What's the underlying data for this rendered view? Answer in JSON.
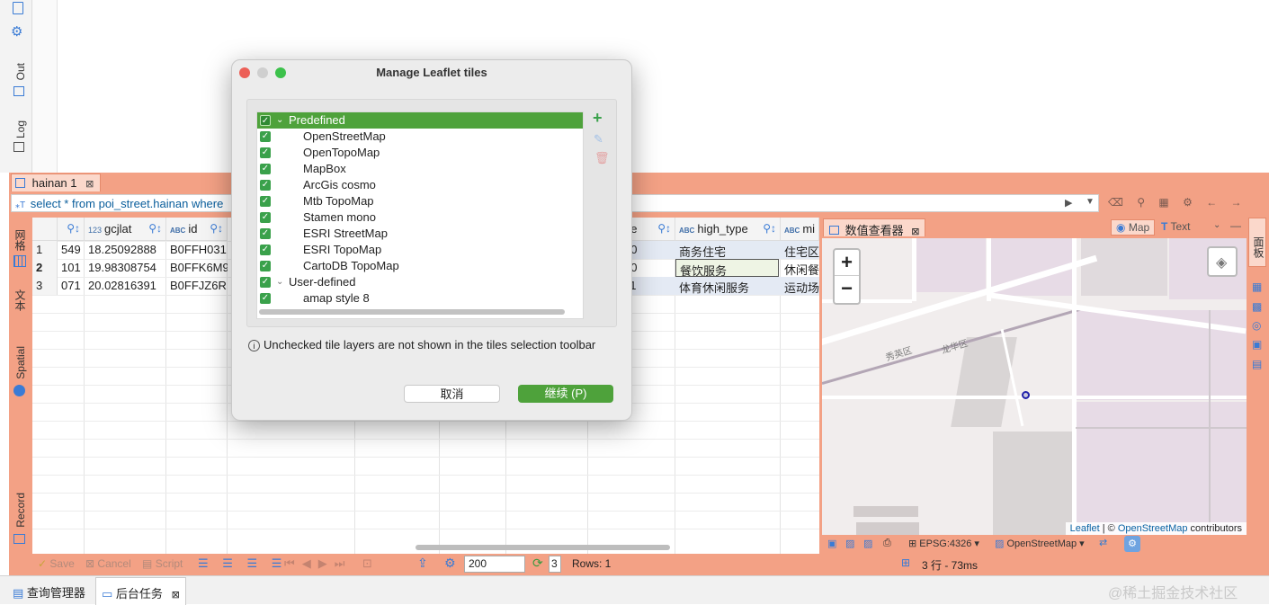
{
  "left_labels": {
    "out": "Out",
    "log": "Log",
    "grid": "网格",
    "text": "文本",
    "spatial": "Spatial",
    "record": "Record"
  },
  "editor_tab": {
    "label": "hainan 1"
  },
  "query": {
    "text": "select * from poi_street.hainan where"
  },
  "grid": {
    "columns": [
      {
        "type_badge": "",
        "label": ""
      },
      {
        "type_badge": "123",
        "label": "gcjlat"
      },
      {
        "type_badge": "ABC",
        "label": "id"
      },
      {
        "type_badge": "",
        "label": "de"
      },
      {
        "type_badge": "ABC",
        "label": "high_type"
      },
      {
        "type_badge": "ABC",
        "label": "mi"
      }
    ],
    "rows": [
      {
        "num": "1",
        "c0": "549",
        "gcjlat": "18.25092888",
        "id": "B0FFH031",
        "de": "00",
        "high_type": "商务住宅",
        "mi": "住宅区"
      },
      {
        "num": "2",
        "c0": "101",
        "gcjlat": "19.98308754",
        "id": "B0FFK6M9",
        "de": "00",
        "high_type": "餐饮服务",
        "mi": "休闲餐"
      },
      {
        "num": "3",
        "c0": "071",
        "gcjlat": "20.02816391",
        "id": "B0FFJZ6R",
        "de": "11",
        "high_type": "体育休闲服务",
        "mi": "运动场"
      }
    ]
  },
  "viewer": {
    "tab_label": "数值查看器",
    "map_button": "Map",
    "text_button": "Text",
    "zoom_in": "+",
    "zoom_out": "−",
    "district1": "秀英区",
    "district2": "龙华区",
    "attribution_leaflet": "Leaflet",
    "attribution_sep": " | © ",
    "attribution_osm": "OpenStreetMap",
    "attribution_tail": " contributors",
    "crs": "EPSG:4326",
    "tiles": "OpenStreetMap"
  },
  "right_strip": {
    "label": "面板"
  },
  "bottom_bar": {
    "save": "Save",
    "cancel": "Cancel",
    "script": "Script",
    "fetch_size": "200",
    "count": "3",
    "rows": "Rows: 1",
    "timing": "3 行 - 73ms"
  },
  "status_tabs": {
    "query_manager": "查询管理器",
    "background_tasks": "后台任务",
    "watermark": "@稀土掘金技术社区"
  },
  "dialog": {
    "title": "Manage Leaflet tiles",
    "tree": [
      {
        "label": "Predefined",
        "level": 0,
        "expanded": true,
        "selected": true
      },
      {
        "label": "OpenStreetMap",
        "level": 1
      },
      {
        "label": "OpenTopoMap",
        "level": 1
      },
      {
        "label": "MapBox",
        "level": 1
      },
      {
        "label": "ArcGis cosmo",
        "level": 1
      },
      {
        "label": "Mtb TopoMap",
        "level": 1
      },
      {
        "label": "Stamen mono",
        "level": 1
      },
      {
        "label": "ESRI StreetMap",
        "level": 1
      },
      {
        "label": "ESRI TopoMap",
        "level": 1
      },
      {
        "label": "CartoDB TopoMap",
        "level": 1
      },
      {
        "label": "User-defined",
        "level": 0,
        "expanded": true
      },
      {
        "label": "amap style 8",
        "level": 1
      }
    ],
    "info": "Unchecked tile layers are not shown in the tiles selection toolbar",
    "cancel_label": "取消",
    "continue_label": "继续 (P)",
    "accent": "#4ea23b"
  }
}
